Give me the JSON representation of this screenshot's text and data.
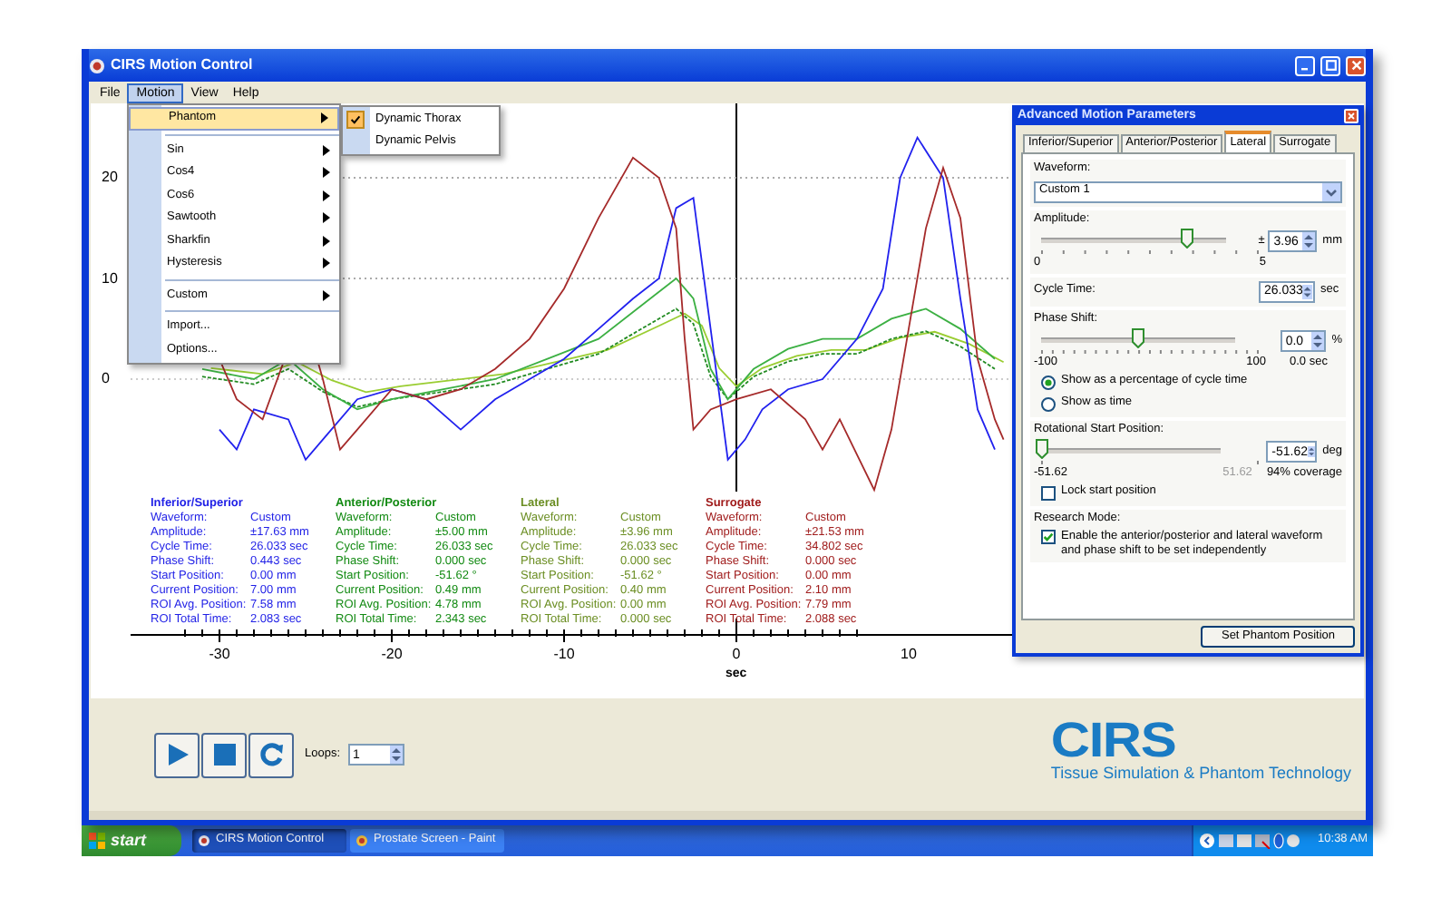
{
  "window": {
    "title": "CIRS Motion Control"
  },
  "menu_bar": [
    {
      "label": "File",
      "selected": false
    },
    {
      "label": "Motion",
      "selected": true
    },
    {
      "label": "View",
      "selected": false
    },
    {
      "label": "Help",
      "selected": false
    }
  ],
  "motion_menu": [
    {
      "kind": "item",
      "label": "Phantom",
      "has_submenu": true,
      "selected": true
    },
    {
      "kind": "separator"
    },
    {
      "kind": "item",
      "label": "Sin",
      "has_submenu": true,
      "selected": false
    },
    {
      "kind": "item",
      "label": "Cos4",
      "has_submenu": true,
      "selected": false
    },
    {
      "kind": "item",
      "label": "Cos6",
      "has_submenu": true,
      "selected": false
    },
    {
      "kind": "item",
      "label": "Sawtooth",
      "has_submenu": true,
      "selected": false
    },
    {
      "kind": "item",
      "label": "Sharkfin",
      "has_submenu": true,
      "selected": false
    },
    {
      "kind": "item",
      "label": "Hysteresis",
      "has_submenu": true,
      "selected": false
    },
    {
      "kind": "separator"
    },
    {
      "kind": "item",
      "label": "Custom",
      "has_submenu": true,
      "selected": false
    },
    {
      "kind": "separator"
    },
    {
      "kind": "item",
      "label": "Import...",
      "has_submenu": false,
      "selected": false
    },
    {
      "kind": "item",
      "label": "Options...",
      "has_submenu": false,
      "selected": false
    }
  ],
  "phantom_submenu": [
    {
      "label": "Dynamic Thorax",
      "checked": true
    },
    {
      "label": "Dynamic Pelvis",
      "checked": false
    }
  ],
  "plot": {
    "y_ticks": [
      "20",
      "10",
      "0"
    ],
    "x_ticks": [
      "-30",
      "-20",
      "-10",
      "0",
      "10"
    ],
    "x_label": "sec"
  },
  "stats": [
    {
      "title": "Inferior/Superior",
      "color": "#1f1fe6",
      "rows": [
        [
          "Waveform:",
          "Custom"
        ],
        [
          "Amplitude:",
          "±17.63 mm"
        ],
        [
          "Cycle Time:",
          "26.033 sec"
        ],
        [
          "Phase Shift:",
          "0.443 sec"
        ],
        [
          "Start Position:",
          "0.00 mm"
        ],
        [
          "Current Position:",
          "7.00 mm"
        ],
        [
          "ROI Avg. Position:",
          "7.58 mm"
        ],
        [
          "ROI Total Time:",
          "2.083 sec"
        ]
      ]
    },
    {
      "title": "Anterior/Posterior",
      "color": "#128a12",
      "rows": [
        [
          "Waveform:",
          "Custom"
        ],
        [
          "Amplitude:",
          "±5.00 mm"
        ],
        [
          "Cycle Time:",
          "26.033 sec"
        ],
        [
          "Phase Shift:",
          "0.000 sec"
        ],
        [
          "Start Position:",
          "-51.62 °"
        ],
        [
          "Current Position:",
          "0.49 mm"
        ],
        [
          "ROI Avg. Position:",
          "4.78 mm"
        ],
        [
          "ROI Total Time:",
          "2.343 sec"
        ]
      ]
    },
    {
      "title": "Lateral",
      "color": "#6b8e23",
      "rows": [
        [
          "Waveform:",
          "Custom"
        ],
        [
          "Amplitude:",
          "±3.96 mm"
        ],
        [
          "Cycle Time:",
          "26.033 sec"
        ],
        [
          "Phase Shift:",
          "0.000 sec"
        ],
        [
          "Start Position:",
          "-51.62 °"
        ],
        [
          "Current Position:",
          "0.40 mm"
        ],
        [
          "ROI Avg. Position:",
          "0.00 mm"
        ],
        [
          "ROI Total Time:",
          "0.000 sec"
        ]
      ]
    },
    {
      "title": "Surrogate",
      "color": "#a01c1c",
      "rows": [
        [
          "Waveform:",
          "Custom"
        ],
        [
          "Amplitude:",
          "±21.53 mm"
        ],
        [
          "Cycle Time:",
          "34.802 sec"
        ],
        [
          "Phase Shift:",
          "0.000 sec"
        ],
        [
          "Start Position:",
          "0.00 mm"
        ],
        [
          "Current Position:",
          "2.10 mm"
        ],
        [
          "ROI Avg. Position:",
          "7.79 mm"
        ],
        [
          "ROI Total Time:",
          "2.088 sec"
        ]
      ]
    }
  ],
  "panel": {
    "title": "Advanced Motion Parameters",
    "tabs": [
      {
        "label": "Inferior/Superior",
        "selected": false
      },
      {
        "label": "Anterior/Posterior",
        "selected": false
      },
      {
        "label": "Lateral",
        "selected": true
      },
      {
        "label": "Surrogate",
        "selected": false
      }
    ],
    "waveform": {
      "label": "Waveform:",
      "value": "Custom 1"
    },
    "amplitude": {
      "label": "Amplitude:",
      "level": 0.79,
      "min": "0",
      "max": "5",
      "prefix": "±",
      "value": "3.96",
      "unit": "mm"
    },
    "cycle_time": {
      "label": "Cycle Time:",
      "value": "26.033",
      "unit": "sec"
    },
    "phase_shift": {
      "label": "Phase Shift:",
      "level": 0.5,
      "min": "-100",
      "max": "100",
      "value": "0.0",
      "unit": "%",
      "reading": "0.0 sec"
    },
    "display_options": [
      {
        "label": "Show as a percentage of cycle time",
        "selected": true
      },
      {
        "label": "Show as time",
        "selected": false
      }
    ],
    "rotation": {
      "label": "Rotational Start Position:",
      "level": 0,
      "min": "-51.62",
      "max": "51.62",
      "value": "-51.62",
      "unit": "deg",
      "reading": "94% coverage"
    },
    "lock": {
      "label": "Lock start position",
      "checked": false
    },
    "research": {
      "label": "Research Mode:",
      "option": {
        "label": "Enable the anterior/posterior and lateral waveform and phase shift to be set independently",
        "checked": true
      }
    },
    "button": "Set Phantom Position"
  },
  "controls": {
    "loops_label": "Loops:",
    "loops_value": "1"
  },
  "logo": {
    "name": "CIRS",
    "tagline": "Tissue Simulation & Phantom Technology"
  },
  "taskbar": {
    "start": "start",
    "tasks": [
      {
        "label": "CIRS Motion Control",
        "selected": true
      },
      {
        "label": "Prostate Screen - Paint",
        "selected": false
      }
    ],
    "clock": "10:38 AM"
  }
}
